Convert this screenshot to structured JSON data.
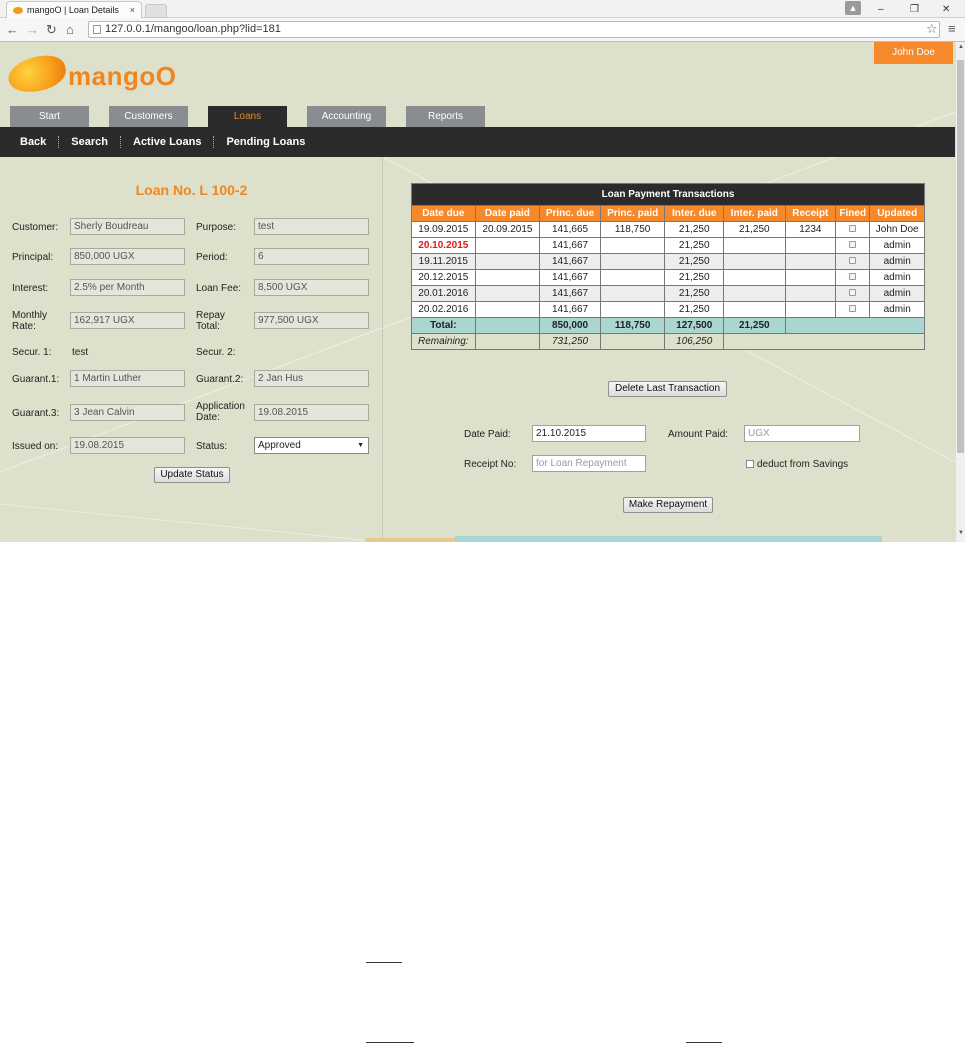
{
  "browser": {
    "tab_title": "mangoO | Loan Details",
    "tab_close": "×",
    "url": "127.0.0.1/mangoo/loan.php?lid=181",
    "controls": {
      "minimize": "–",
      "restore": "❐",
      "close": "✕"
    }
  },
  "header": {
    "logo_text": "mangoO",
    "user_button": "John Doe"
  },
  "main_nav": [
    {
      "label": "Start",
      "active": false
    },
    {
      "label": "Customers",
      "active": false
    },
    {
      "label": "Loans",
      "active": true
    },
    {
      "label": "Accounting",
      "active": false
    },
    {
      "label": "Reports",
      "active": false
    }
  ],
  "sub_nav": [
    {
      "label": "Back"
    },
    {
      "label": "Search"
    },
    {
      "label": "Active Loans"
    },
    {
      "label": "Pending Loans"
    }
  ],
  "loan": {
    "title": "Loan No. L 100-2",
    "fields": {
      "customer": {
        "label": "Customer:",
        "value": "Sherly Boudreau"
      },
      "purpose": {
        "label": "Purpose:",
        "value": "test"
      },
      "principal": {
        "label": "Principal:",
        "value": "850,000 UGX"
      },
      "period": {
        "label": "Period:",
        "value": "6"
      },
      "interest": {
        "label": "Interest:",
        "value": "2.5% per Month"
      },
      "loan_fee": {
        "label": "Loan Fee:",
        "value": "8,500 UGX"
      },
      "monthly_rate": {
        "label_line1": "Monthly",
        "label_line2": "Rate:",
        "value": "162,917 UGX"
      },
      "repay_total": {
        "label_line1": "Repay",
        "label_line2": "Total:",
        "value": "977,500 UGX"
      },
      "secur1": {
        "label": "Secur. 1:",
        "value": "test"
      },
      "secur2": {
        "label": "Secur. 2:",
        "value": ""
      },
      "guarant1": {
        "label": "Guarant.1:",
        "value": "1 Martin Luther"
      },
      "guarant2": {
        "label": "Guarant.2:",
        "value": "2 Jan Hus"
      },
      "guarant3": {
        "label": "Guarant.3:",
        "value": "3 Jean Calvin"
      },
      "application_date": {
        "label_line1": "Application",
        "label_line2": "Date:",
        "value": "19.08.2015"
      },
      "issued_on": {
        "label": "Issued on:",
        "value": "19.08.2015"
      },
      "status": {
        "label": "Status:",
        "value": "Approved"
      }
    },
    "update_status_button": "Update Status"
  },
  "payments": {
    "caption": "Loan Payment Transactions",
    "columns": [
      "Date due",
      "Date paid",
      "Princ. due",
      "Princ. paid",
      "Inter. due",
      "Inter. paid",
      "Receipt",
      "Fined",
      "Updated"
    ],
    "rows": [
      {
        "date_due": "19.09.2015",
        "date_paid": "20.09.2015",
        "princ_due": "141,665",
        "princ_paid": "118,750",
        "inter_due": "21,250",
        "inter_paid": "21,250",
        "receipt": "1234",
        "fined": false,
        "updated": "John Doe",
        "overdue": false
      },
      {
        "date_due": "20.10.2015",
        "date_paid": "",
        "princ_due": "141,667",
        "princ_paid": "",
        "inter_due": "21,250",
        "inter_paid": "",
        "receipt": "",
        "fined": false,
        "updated": "admin",
        "overdue": true
      },
      {
        "date_due": "19.11.2015",
        "date_paid": "",
        "princ_due": "141,667",
        "princ_paid": "",
        "inter_due": "21,250",
        "inter_paid": "",
        "receipt": "",
        "fined": false,
        "updated": "admin",
        "overdue": false
      },
      {
        "date_due": "20.12.2015",
        "date_paid": "",
        "princ_due": "141,667",
        "princ_paid": "",
        "inter_due": "21,250",
        "inter_paid": "",
        "receipt": "",
        "fined": false,
        "updated": "admin",
        "overdue": false
      },
      {
        "date_due": "20.01.2016",
        "date_paid": "",
        "princ_due": "141,667",
        "princ_paid": "",
        "inter_due": "21,250",
        "inter_paid": "",
        "receipt": "",
        "fined": false,
        "updated": "admin",
        "overdue": false
      },
      {
        "date_due": "20.02.2016",
        "date_paid": "",
        "princ_due": "141,667",
        "princ_paid": "",
        "inter_due": "21,250",
        "inter_paid": "",
        "receipt": "",
        "fined": false,
        "updated": "admin",
        "overdue": false
      }
    ],
    "total": {
      "label": "Total:",
      "princ_due": "850,000",
      "princ_paid": "118,750",
      "inter_due": "127,500",
      "inter_paid": "21,250"
    },
    "remaining": {
      "label": "Remaining:",
      "princ_due": "731,250",
      "inter_due": "106,250"
    },
    "delete_last_button": "Delete Last Transaction"
  },
  "repayment": {
    "date_paid_label": "Date Paid:",
    "date_paid_value": "21.10.2015",
    "amount_paid_label": "Amount Paid:",
    "amount_paid_placeholder": "UGX",
    "receipt_no_label": "Receipt No:",
    "receipt_no_placeholder": "for Loan Repayment",
    "deduct_label": "deduct from Savings",
    "make_repayment_button": "Make Repayment"
  },
  "colors": {
    "accent": "#f5892b",
    "nav_dark": "#2b2b2b",
    "page_bg": "#dde0cb",
    "total_row": "#a9d6d1",
    "overdue": "#e0181c"
  }
}
